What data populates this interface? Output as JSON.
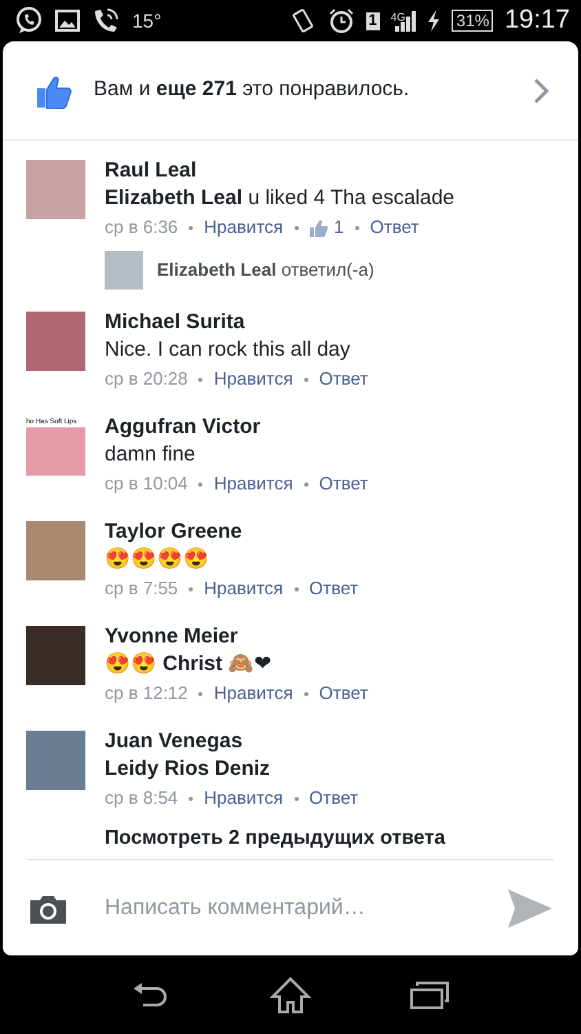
{
  "status_bar": {
    "temperature": "15°",
    "sim": "1",
    "network": "4G",
    "battery": "31%",
    "time": "19:17"
  },
  "likes_banner": {
    "text": "Вам и **еще 271** это понравилось."
  },
  "comments": [
    {
      "author": "Raul Leal",
      "body": "**Elizabeth Leal** u liked 4 Tha escalade",
      "time": "ср в 6:36",
      "like_label": "Нравится",
      "like_count": "1",
      "reply_label": "Ответ",
      "reply_preview": {
        "author": "Elizabeth Leal",
        "action": "ответил(-а)"
      }
    },
    {
      "author": "Michael Surita",
      "body": "Nice. I can rock this all day",
      "time": "ср в 20:28",
      "like_label": "Нравится",
      "reply_label": "Ответ"
    },
    {
      "author": "Aggufran Victor",
      "avatar_caption": "ho Has Soft Lips",
      "body": "damn fine",
      "time": "ср в 10:04",
      "like_label": "Нравится",
      "reply_label": "Ответ"
    },
    {
      "author": "Taylor Greene",
      "body": "😍😍😍😍",
      "time": "ср в 7:55",
      "like_label": "Нравится",
      "reply_label": "Ответ"
    },
    {
      "author": "Yvonne Meier",
      "body": "😍😍 **Christ** 🙈❤",
      "time": "ср в 12:12",
      "like_label": "Нравится",
      "reply_label": "Ответ"
    },
    {
      "author": "Juan Venegas",
      "body": "**Leidy Rios Deniz**",
      "time": "ср в 8:54",
      "like_label": "Нравится",
      "reply_label": "Ответ",
      "more_replies": "Посмотреть 2 предыдущих ответа"
    }
  ],
  "composer": {
    "placeholder": "Написать комментарий…"
  }
}
